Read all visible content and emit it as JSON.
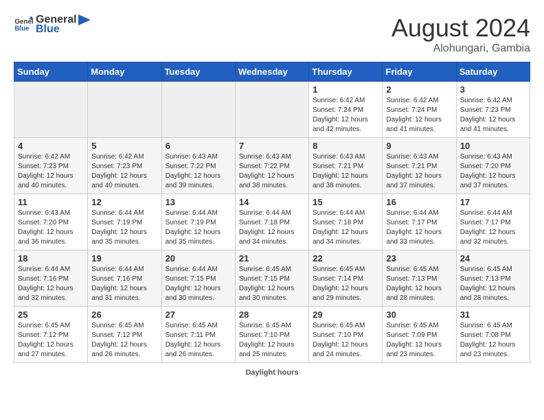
{
  "header": {
    "logo_general": "General",
    "logo_blue": "Blue",
    "month_year": "August 2024",
    "location": "Alohungari, Gambia"
  },
  "days_of_week": [
    "Sunday",
    "Monday",
    "Tuesday",
    "Wednesday",
    "Thursday",
    "Friday",
    "Saturday"
  ],
  "weeks": [
    [
      {
        "day": "",
        "info": ""
      },
      {
        "day": "",
        "info": ""
      },
      {
        "day": "",
        "info": ""
      },
      {
        "day": "",
        "info": ""
      },
      {
        "day": "1",
        "info": "Sunrise: 6:42 AM\nSunset: 7:24 PM\nDaylight: 12 hours and 42 minutes."
      },
      {
        "day": "2",
        "info": "Sunrise: 6:42 AM\nSunset: 7:24 PM\nDaylight: 12 hours and 41 minutes."
      },
      {
        "day": "3",
        "info": "Sunrise: 6:42 AM\nSunset: 7:23 PM\nDaylight: 12 hours and 41 minutes."
      }
    ],
    [
      {
        "day": "4",
        "info": "Sunrise: 6:42 AM\nSunset: 7:23 PM\nDaylight: 12 hours and 40 minutes."
      },
      {
        "day": "5",
        "info": "Sunrise: 6:42 AM\nSunset: 7:23 PM\nDaylight: 12 hours and 40 minutes."
      },
      {
        "day": "6",
        "info": "Sunrise: 6:43 AM\nSunset: 7:22 PM\nDaylight: 12 hours and 39 minutes."
      },
      {
        "day": "7",
        "info": "Sunrise: 6:43 AM\nSunset: 7:22 PM\nDaylight: 12 hours and 38 minutes."
      },
      {
        "day": "8",
        "info": "Sunrise: 6:43 AM\nSunset: 7:21 PM\nDaylight: 12 hours and 38 minutes."
      },
      {
        "day": "9",
        "info": "Sunrise: 6:43 AM\nSunset: 7:21 PM\nDaylight: 12 hours and 37 minutes."
      },
      {
        "day": "10",
        "info": "Sunrise: 6:43 AM\nSunset: 7:20 PM\nDaylight: 12 hours and 37 minutes."
      }
    ],
    [
      {
        "day": "11",
        "info": "Sunrise: 6:43 AM\nSunset: 7:20 PM\nDaylight: 12 hours and 36 minutes."
      },
      {
        "day": "12",
        "info": "Sunrise: 6:44 AM\nSunset: 7:19 PM\nDaylight: 12 hours and 35 minutes."
      },
      {
        "day": "13",
        "info": "Sunrise: 6:44 AM\nSunset: 7:19 PM\nDaylight: 12 hours and 35 minutes."
      },
      {
        "day": "14",
        "info": "Sunrise: 6:44 AM\nSunset: 7:18 PM\nDaylight: 12 hours and 34 minutes."
      },
      {
        "day": "15",
        "info": "Sunrise: 6:44 AM\nSunset: 7:18 PM\nDaylight: 12 hours and 34 minutes."
      },
      {
        "day": "16",
        "info": "Sunrise: 6:44 AM\nSunset: 7:17 PM\nDaylight: 12 hours and 33 minutes."
      },
      {
        "day": "17",
        "info": "Sunrise: 6:44 AM\nSunset: 7:17 PM\nDaylight: 12 hours and 32 minutes."
      }
    ],
    [
      {
        "day": "18",
        "info": "Sunrise: 6:44 AM\nSunset: 7:16 PM\nDaylight: 12 hours and 32 minutes."
      },
      {
        "day": "19",
        "info": "Sunrise: 6:44 AM\nSunset: 7:16 PM\nDaylight: 12 hours and 31 minutes."
      },
      {
        "day": "20",
        "info": "Sunrise: 6:44 AM\nSunset: 7:15 PM\nDaylight: 12 hours and 30 minutes."
      },
      {
        "day": "21",
        "info": "Sunrise: 6:45 AM\nSunset: 7:15 PM\nDaylight: 12 hours and 30 minutes."
      },
      {
        "day": "22",
        "info": "Sunrise: 6:45 AM\nSunset: 7:14 PM\nDaylight: 12 hours and 29 minutes."
      },
      {
        "day": "23",
        "info": "Sunrise: 6:45 AM\nSunset: 7:13 PM\nDaylight: 12 hours and 28 minutes."
      },
      {
        "day": "24",
        "info": "Sunrise: 6:45 AM\nSunset: 7:13 PM\nDaylight: 12 hours and 28 minutes."
      }
    ],
    [
      {
        "day": "25",
        "info": "Sunrise: 6:45 AM\nSunset: 7:12 PM\nDaylight: 12 hours and 27 minutes."
      },
      {
        "day": "26",
        "info": "Sunrise: 6:45 AM\nSunset: 7:12 PM\nDaylight: 12 hours and 26 minutes."
      },
      {
        "day": "27",
        "info": "Sunrise: 6:45 AM\nSunset: 7:11 PM\nDaylight: 12 hours and 26 minutes."
      },
      {
        "day": "28",
        "info": "Sunrise: 6:45 AM\nSunset: 7:10 PM\nDaylight: 12 hours and 25 minutes."
      },
      {
        "day": "29",
        "info": "Sunrise: 6:45 AM\nSunset: 7:10 PM\nDaylight: 12 hours and 24 minutes."
      },
      {
        "day": "30",
        "info": "Sunrise: 6:45 AM\nSunset: 7:09 PM\nDaylight: 12 hours and 23 minutes."
      },
      {
        "day": "31",
        "info": "Sunrise: 6:45 AM\nSunset: 7:08 PM\nDaylight: 12 hours and 23 minutes."
      }
    ]
  ],
  "footer": {
    "label": "Daylight hours"
  },
  "colors": {
    "header_bg": "#2060c0",
    "accent": "#2060c0"
  }
}
